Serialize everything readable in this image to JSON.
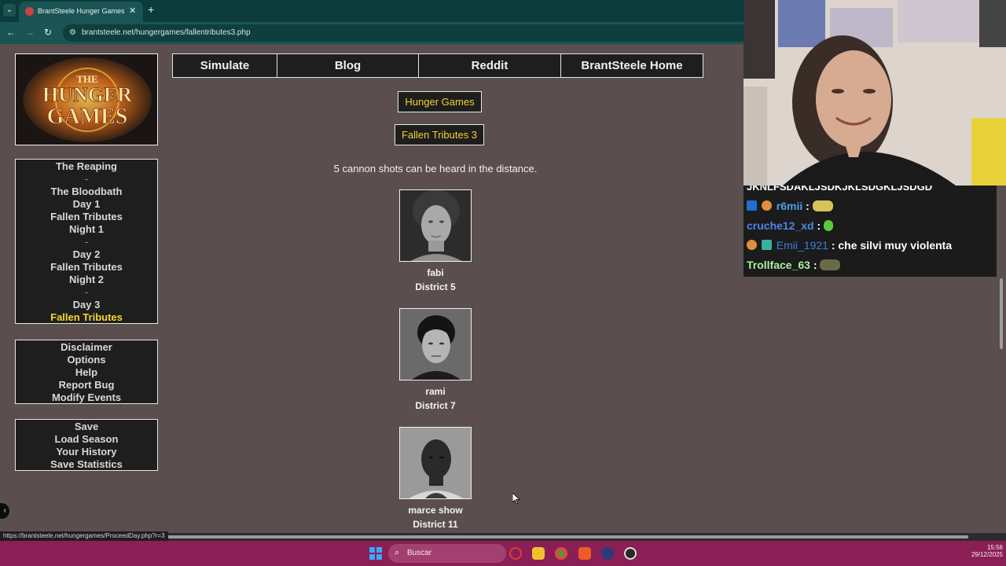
{
  "browser": {
    "tab_title": "BrantSteele Hunger Games Sim",
    "url": "brantsteele.net/hungergames/fallentributes3.php",
    "status_url": "https://brantsteele.net/hungergames/ProceedDay.php?r=3"
  },
  "logo": {
    "line1": "THE",
    "line2": "HUNGER",
    "line3": "GAMES"
  },
  "sidebar": {
    "progress": [
      "The Reaping",
      "-",
      "The Bloodbath",
      "Day 1",
      "Fallen Tributes",
      "Night 1",
      "-",
      "Day 2",
      "Fallen Tributes",
      "Night 2",
      "-",
      "Day 3",
      "Fallen Tributes"
    ],
    "links": [
      "Disclaimer",
      "Options",
      "Help",
      "Report Bug",
      "Modify Events"
    ],
    "save": [
      "Save",
      "Load Season",
      "Your History",
      "Save Statistics"
    ]
  },
  "topnav": [
    "Simulate",
    "Blog",
    "Reddit",
    "BrantSteele Home"
  ],
  "main": {
    "game_title": "Hunger Games",
    "section_title": "Fallen Tributes 3",
    "cannon_message": "5 cannon shots can be heard in the distance.",
    "tributes": [
      {
        "name": "fabi",
        "district": "District 5"
      },
      {
        "name": "rami",
        "district": "District 7"
      },
      {
        "name": "marce show",
        "district": "District 11"
      }
    ]
  },
  "chat": {
    "partial_line": "JKNLFSDAKLJSDKJKLSDGKLJSDGD",
    "messages": [
      {
        "user": "r6mii",
        "sep": ":",
        "text": "",
        "color": "#4a9fe8"
      },
      {
        "user": "cruche12_xd",
        "sep": ":",
        "text": "",
        "color": "#4a86e8"
      },
      {
        "user": "Emii_1921",
        "sep": ":",
        "text": "che silvi muy violenta",
        "color": "#3c7ee0"
      },
      {
        "user": "Trollface_63",
        "sep": ":",
        "text": "",
        "color": "#a8f0a0"
      }
    ]
  },
  "taskbar": {
    "search_placeholder": "Buscar",
    "time": "15:56",
    "date": "29/12/2025"
  }
}
